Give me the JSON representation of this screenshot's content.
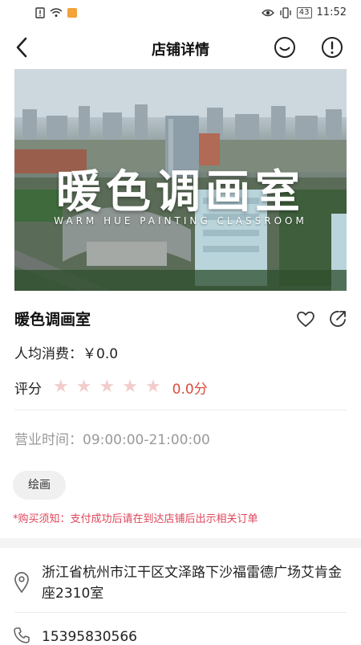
{
  "status_bar": {
    "time": "11:52",
    "battery": "43"
  },
  "header": {
    "title": "店铺详情",
    "icons": [
      "back-icon",
      "customer-service-icon",
      "report-icon"
    ]
  },
  "hero": {
    "title": "暖色调画室",
    "subtitle": "WARM HUE PAINTING CLASSROOM"
  },
  "shop": {
    "name": "暖色调画室",
    "price": "人均消费：￥0.0",
    "rating_label": "评分",
    "rating_stars": 0,
    "rating_max": 5,
    "rating_value": "0.0分",
    "hours": "营业时间：09:00:00-21:00:00",
    "tag": "绘画",
    "notice": "*购买须知：支付成功后请在到达店铺后出示相关订单"
  },
  "contact": {
    "address": "浙江省杭州市江干区文泽路下沙福雷德广场艾肯金座2310室",
    "phone": "15395830566"
  },
  "colors": {
    "accent_red": "#d94b3d",
    "notice_pink": "#e0455a",
    "star_empty": "#f3cccc"
  }
}
